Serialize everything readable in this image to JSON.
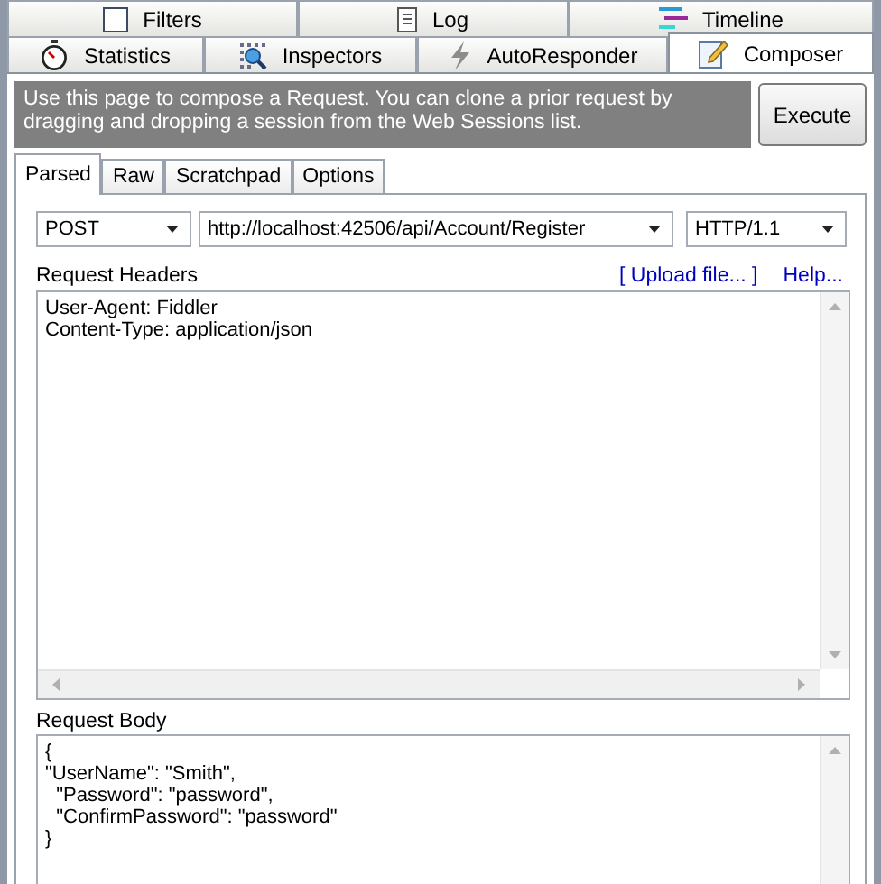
{
  "top_tabs": [
    {
      "label": "Filters",
      "selected": false
    },
    {
      "label": "Log",
      "selected": false
    },
    {
      "label": "Timeline",
      "selected": false
    }
  ],
  "tabs": [
    {
      "label": "Statistics",
      "selected": false
    },
    {
      "label": "Inspectors",
      "selected": false
    },
    {
      "label": "AutoResponder",
      "selected": false
    },
    {
      "label": "Composer",
      "selected": true
    }
  ],
  "info": "Use this page to compose a Request. You can clone a prior request by dragging and dropping a session from the Web Sessions list.",
  "execute_button": "Execute",
  "subtabs": [
    {
      "label": "Parsed",
      "selected": true
    },
    {
      "label": "Raw",
      "selected": false
    },
    {
      "label": "Scratchpad",
      "selected": false
    },
    {
      "label": "Options",
      "selected": false
    }
  ],
  "method": "POST",
  "url": "http://localhost:42506/api/Account/Register",
  "version": "HTTP/1.1",
  "headers_label": "Request Headers",
  "links": [
    "[ Upload file... ]",
    "Help..."
  ],
  "headers": "User-Agent: Fiddler\nContent-Type: application/json",
  "body_label": "Request Body",
  "body": "{\n\"UserName\": \"Smith\",\n  \"Password\": \"password\",\n  \"ConfirmPassword\": \"password\"\n}"
}
